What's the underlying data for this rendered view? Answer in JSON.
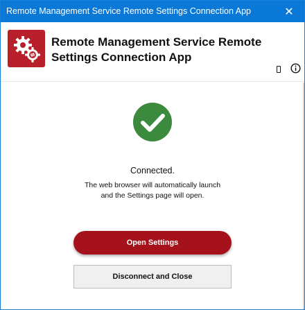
{
  "window": {
    "title": "Remote Management Service Remote Settings Connection App",
    "close_glyph": "✕",
    "accent_color": "#0a78d7"
  },
  "header": {
    "app_title": "Remote Management Service Remote Settings Connection App",
    "logo_icon": "gears-exchange-icon",
    "logo_color": "#b81f2a",
    "icons": [
      "device-icon",
      "info-icon"
    ]
  },
  "main": {
    "status_icon": "checkmark-icon",
    "status_color": "#3b8a3e",
    "status_text": "Connected.",
    "message_line1": "The web browser will automatically launch",
    "message_line2": "and the Settings page will open."
  },
  "buttons": {
    "open_settings": "Open Settings",
    "disconnect_close": "Disconnect and Close"
  }
}
